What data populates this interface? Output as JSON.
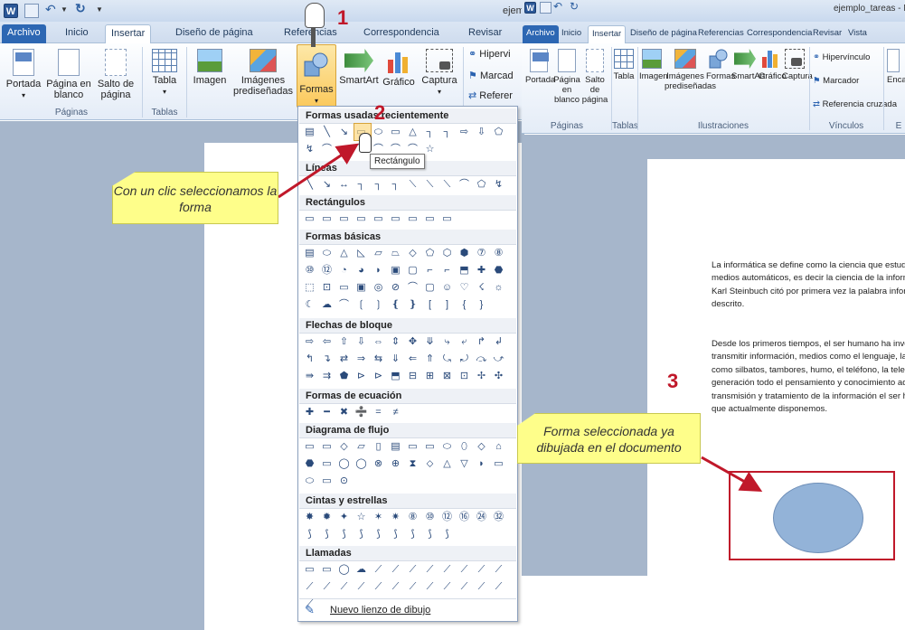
{
  "left_window": {
    "title": "ejem",
    "tabs": [
      "Archivo",
      "Inicio",
      "Insertar",
      "Diseño de página",
      "Referencias",
      "Correspondencia",
      "Revisar"
    ],
    "active_tab": "Insertar",
    "ribbon": {
      "cover": "Portada",
      "blank_page": "Página en blanco",
      "page_break": "Salto de página",
      "group_pages": "Páginas",
      "table": "Tabla",
      "group_tables": "Tablas",
      "image": "Imagen",
      "clipart": "Imágenes prediseñadas",
      "shapes": "Formas",
      "smartart": "SmartArt",
      "chart": "Gráfico",
      "screenshot": "Captura",
      "hyperlink": "Hipervi",
      "bookmark": "Marcad",
      "crossref": "Referer"
    }
  },
  "shapes_menu": {
    "sections": [
      "Formas usadas recientemente",
      "Líneas",
      "Rectángulos",
      "Formas básicas",
      "Flechas de bloque",
      "Formas de ecuación",
      "Diagrama de flujo",
      "Cintas y estrellas",
      "Llamadas"
    ],
    "tooltip": "Rectángulo",
    "new_canvas": "Nuevo lienzo de dibujo"
  },
  "right_window": {
    "title": "ejemplo_tareas - Micros",
    "tabs": [
      "Archivo",
      "Inicio",
      "Insertar",
      "Diseño de página",
      "Referencias",
      "Correspondencia",
      "Revisar",
      "Vista"
    ],
    "ribbon": {
      "cover": "Portada",
      "blank_page": "Página en blanco",
      "page_break": "Salto de página",
      "table": "Tabla",
      "image": "Imagen",
      "clipart": "Imágenes prediseñadas",
      "shapes": "Formas",
      "smartart": "SmartArt",
      "chart": "Gráfico",
      "screenshot": "Captura",
      "hyperlink": "Hipervínculo",
      "bookmark": "Marcador",
      "crossref": "Referencia cruzada",
      "header_cut": "Encab",
      "group_pages": "Páginas",
      "group_tables": "Tablas",
      "group_illustrations": "Ilustraciones",
      "group_links": "Vínculos",
      "group_cut": "E"
    },
    "document": {
      "para1": [
        "La informática se define como la ciencia que estudia el",
        "medios automáticos, es decir la ciencia de la información",
        "Karl Steinbuch citó por primera vez la palabra inform",
        "descrito."
      ],
      "para2": [
        "Desde los primeros tiempos, el ser humano ha inventac",
        "transmitir información, medios como el lenguaje, la esc",
        "como silbatos, tambores, humo, el teléfono, la televisió",
        "generación todo el pensamiento y conocimiento adquiri",
        "transmisión y tratamiento de la información el ser huma",
        "que actualmente disponemos."
      ]
    }
  },
  "annotations": {
    "step1": "1",
    "step2": "2",
    "step3": "3",
    "callout1": "Con un clic seleccionamos la forma",
    "callout2": "Forma seleccionada ya dibujada en el documento"
  },
  "colors": {
    "accent_red": "#c0182a",
    "callout_yellow": "#fefe8a",
    "ellipse_fill": "#93b3d8"
  }
}
